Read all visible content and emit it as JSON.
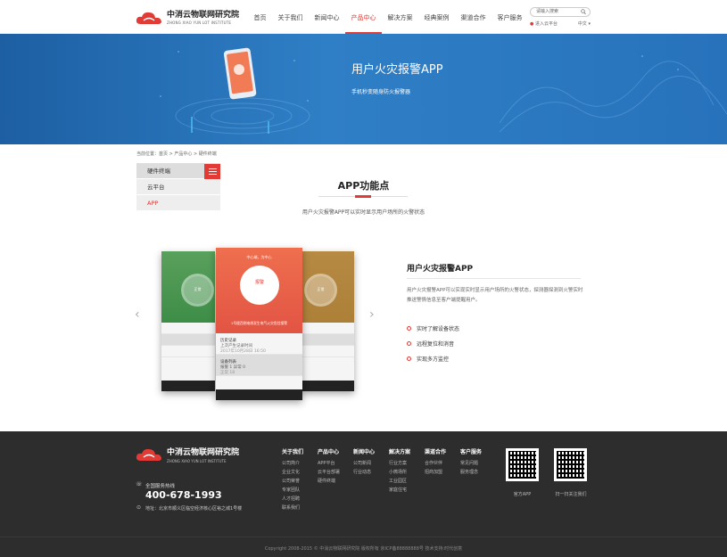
{
  "header": {
    "logo_cn": "中消云物联网研究院",
    "logo_en": "ZHONG XIAO YUN LOT INSTITUTE",
    "nav": [
      "首页",
      "关于我们",
      "新闻中心",
      "产品中心",
      "解决方案",
      "经典案例",
      "渠道合作",
      "客户服务"
    ],
    "active_nav": "产品中心",
    "search_placeholder": "请输入搜索",
    "cloud_link": "进入云平台",
    "lang": "中文"
  },
  "banner": {
    "title": "用户火灾报警APP",
    "subtitle": "手机秒变随身防火报警器"
  },
  "breadcrumb": "当前位置：首页 > 产品中心 > 硬件终端",
  "sidebar": {
    "items": [
      "硬件终端",
      "云平台",
      "APP"
    ],
    "active": "APP"
  },
  "section": {
    "title": "APP功能点",
    "desc": "用户火灾报警APP可以实时显示用户场所的火警状态"
  },
  "phones": {
    "center_top": "中心端，为中心",
    "center_dial": "报警",
    "center_bottom": "1号楼西侧电线发生电气火灾危险报警",
    "center_rows": [
      {
        "label": "历史记录",
        "text": "上次产生记录时间",
        "time": "2017年10月28日 16:50"
      },
      {
        "label": "设备列表",
        "text": "报警 1  异常 0",
        "time": "正常 18"
      }
    ],
    "left_dial": "正常",
    "right_dial": "正常"
  },
  "feature": {
    "title": "用户火灾报警APP",
    "desc": "用户火灾报警APP可以实现实时显示用户场所的火警状态，探测器探测到火警实时推送警情信息至客户端提醒用户。",
    "list": [
      "实时了解设备状态",
      "远程复位和消音",
      "实现多方监控"
    ]
  },
  "footer": {
    "logo_cn": "中消云物联网研究院",
    "logo_en": "ZHONG XIAO YUN LOT INSTITUTE",
    "hotline_label": "全国服务热线",
    "hotline": "400-678-1993",
    "address": "地址：北京市顺义区临空经济核心区裕之城1号楼",
    "columns": [
      {
        "title": "关于我们",
        "items": [
          "公司简介",
          "企业文化",
          "公司荣誉",
          "专家团队",
          "人才招聘",
          "联系我们"
        ]
      },
      {
        "title": "产品中心",
        "items": [
          "APP平台",
          "云平台部署",
          "硬件终端"
        ]
      },
      {
        "title": "新闻中心",
        "items": [
          "公司新闻",
          "行业动态"
        ]
      },
      {
        "title": "解决方案",
        "items": [
          "行业方案",
          "小微场所",
          "工业园区",
          "家庭住宅"
        ]
      },
      {
        "title": "渠道合作",
        "items": [
          "合作伙伴",
          "招商加盟"
        ]
      },
      {
        "title": "客户服务",
        "items": [
          "常见问题",
          "服务理念"
        ]
      }
    ],
    "qr_labels": [
      "官方APP",
      "扫一扫关注我们"
    ],
    "copyright": "Copyright 2008-2015 © 中消云物联网研究院 版权所有  京ICP备88888888号  技术支持:时代创意"
  },
  "colors": {
    "accent": "#e23a35",
    "banner": "#2772bb",
    "footer": "#2d2d2d"
  }
}
